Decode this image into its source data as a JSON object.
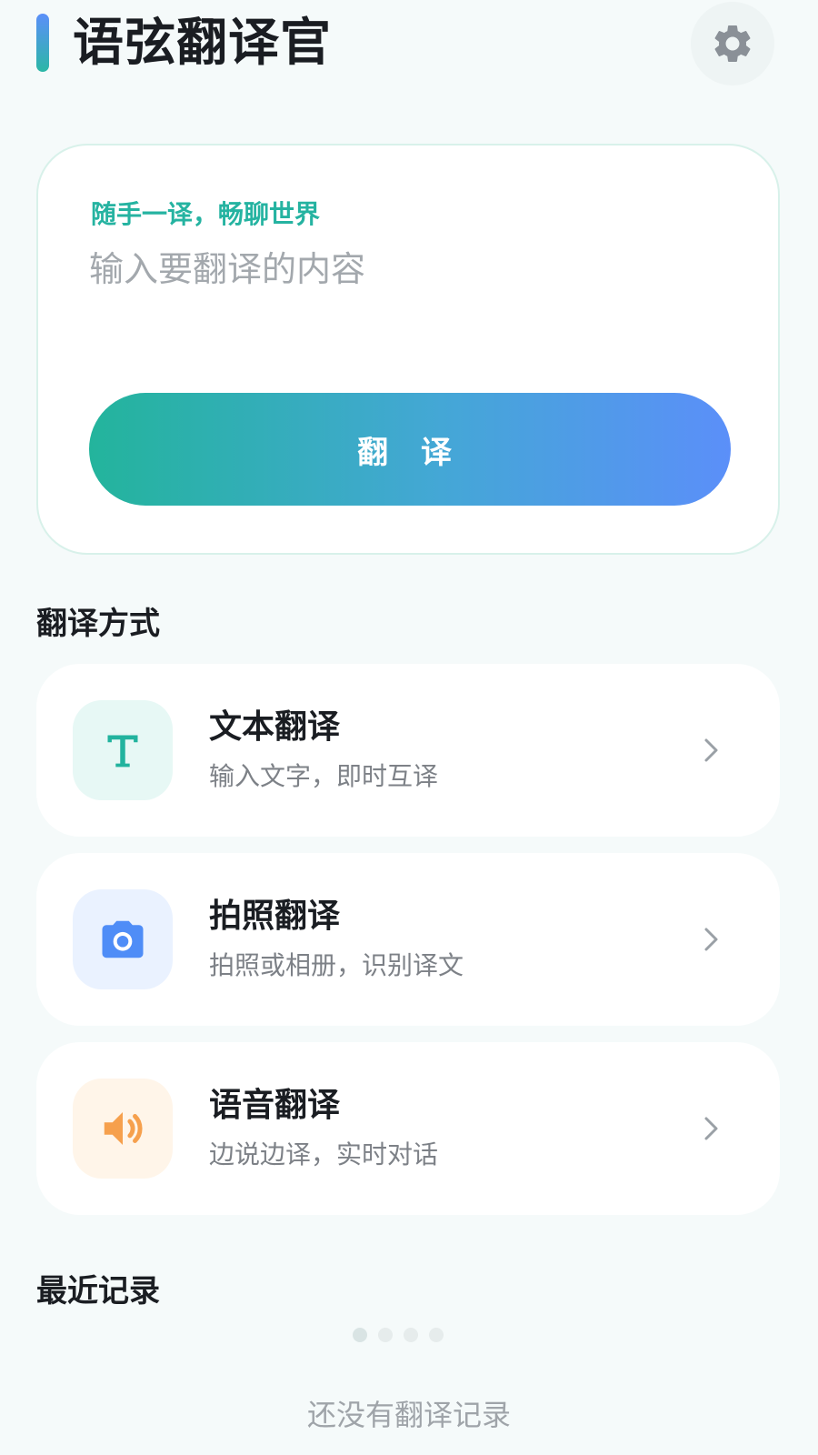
{
  "header": {
    "app_title": "语弦翻译官",
    "settings_icon": "gear-icon"
  },
  "input_card": {
    "slogan": "随手一译，畅聊世界",
    "placeholder": "输入要翻译的内容",
    "value": "",
    "translate_button": "翻 译"
  },
  "modes": {
    "section_title": "翻译方式",
    "items": [
      {
        "title": "文本翻译",
        "description": "输入文字，即时互译",
        "icon": "text-t-icon",
        "icon_color": "#22b39e",
        "icon_bg": "#e7f8f5"
      },
      {
        "title": "拍照翻译",
        "description": "拍照或相册，识别译文",
        "icon": "camera-icon",
        "icon_color": "#4f8df7",
        "icon_bg": "#eaf2ff"
      },
      {
        "title": "语音翻译",
        "description": "边说边译，实时对话",
        "icon": "speaker-icon",
        "icon_color": "#f6a04d",
        "icon_bg": "#fff5e9"
      }
    ]
  },
  "recent": {
    "section_title": "最近记录",
    "empty_text": "还没有翻译记录"
  },
  "colors": {
    "accent_teal": "#25b3a1",
    "accent_blue": "#5b8ff9",
    "page_bg": "#f5fafa"
  }
}
